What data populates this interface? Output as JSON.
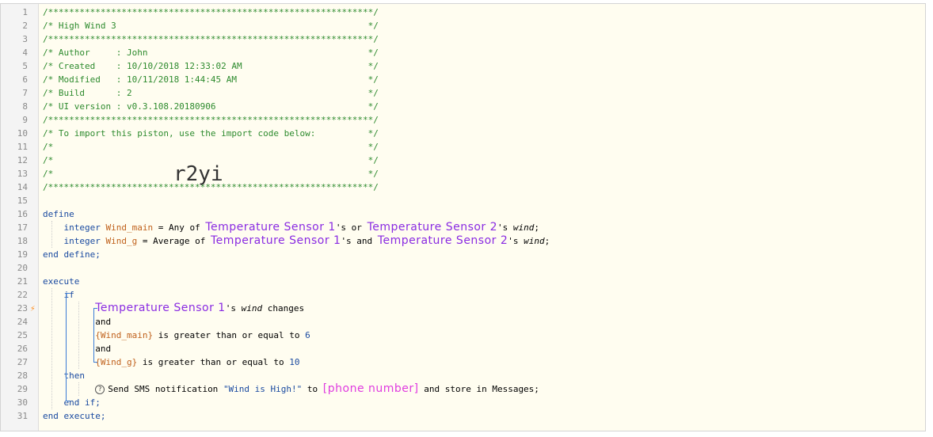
{
  "lines": [
    {
      "n": "1",
      "html": "<span class='cm'>/**************************************************************/</span>"
    },
    {
      "n": "2",
      "html": "<span class='cm'>/* High Wind 3                                                */</span>"
    },
    {
      "n": "3",
      "html": "<span class='cm'>/**************************************************************/</span>"
    },
    {
      "n": "4",
      "html": "<span class='cm'>/* Author     : John                                          */</span>"
    },
    {
      "n": "5",
      "html": "<span class='cm'>/* Created    : 10/10/2018 12:33:02 AM                        */</span>"
    },
    {
      "n": "6",
      "html": "<span class='cm'>/* Modified   : 10/11/2018 1:44:45 AM                         */</span>"
    },
    {
      "n": "7",
      "html": "<span class='cm'>/* Build      : 2                                             */</span>"
    },
    {
      "n": "8",
      "html": "<span class='cm'>/* UI version : v0.3.108.20180906                             */</span>"
    },
    {
      "n": "9",
      "html": "<span class='cm'>/**************************************************************/</span>"
    },
    {
      "n": "10",
      "html": "<span class='cm'>/* To import this piston, use the import code below:          */</span>"
    },
    {
      "n": "11",
      "html": "<span class='cm'>/*                                                            */</span>"
    },
    {
      "n": "12",
      "html": "<span class='cm'>/*                                                            */</span>"
    },
    {
      "n": "13",
      "html": "<span class='cm'>/*                                                            */</span>"
    },
    {
      "n": "14",
      "html": "<span class='cm'>/**************************************************************/</span>"
    },
    {
      "n": "15",
      "html": ""
    },
    {
      "n": "16",
      "html": "<span class='kw'>define</span>"
    },
    {
      "n": "17",
      "html": "    <span class='kw'>integer</span> <span class='vr'>Wind_main</span> = Any of <span class='dv'>Temperature Sensor 1</span>'s or <span class='dv'>Temperature Sensor 2</span>'s <span class='it'>wind</span>;"
    },
    {
      "n": "18",
      "html": "    <span class='kw'>integer</span> <span class='vr'>Wind_g</span> = Average of <span class='dv'>Temperature Sensor 1</span>'s and <span class='dv'>Temperature Sensor 2</span>'s <span class='it'>wind</span>;"
    },
    {
      "n": "19",
      "html": "<span class='kw'>end define;</span>"
    },
    {
      "n": "20",
      "html": ""
    },
    {
      "n": "21",
      "html": "<span class='kw'>execute</span>"
    },
    {
      "n": "22",
      "html": "    <span class='kw'>if</span>"
    },
    {
      "n": "23",
      "html": "          <span class='dv'>Temperature Sensor 1</span>'s <span class='it'>wind</span> changes"
    },
    {
      "n": "24",
      "html": "          and"
    },
    {
      "n": "25",
      "html": "          <span class='vr'>{Wind_main}</span> is greater than or equal to <span class='num'>6</span>"
    },
    {
      "n": "26",
      "html": "          and"
    },
    {
      "n": "27",
      "html": "          <span class='vr'>{Wind_g}</span> is greater than or equal to <span class='num'>10</span>"
    },
    {
      "n": "28",
      "html": "    <span class='kw'>then</span>"
    },
    {
      "n": "29",
      "html": "          <span class='qm'>?</span>Send SMS notification <span class='str'>\"Wind is High!\"</span> to <span class='ph'>[phone number]</span> and store in Messages;"
    },
    {
      "n": "30",
      "html": "    <span class='kw'>end if;</span>"
    },
    {
      "n": "31",
      "html": "<span class='kw'>end execute;</span>"
    }
  ],
  "import_code": "r2yi",
  "trigger_line": "23",
  "colors": {
    "comment": "#2e8b2e",
    "keyword": "#1a4aa0",
    "variable": "#c0611c",
    "device": "#8a2be2",
    "phone": "#e03ce0",
    "background": "#fffdf0"
  }
}
